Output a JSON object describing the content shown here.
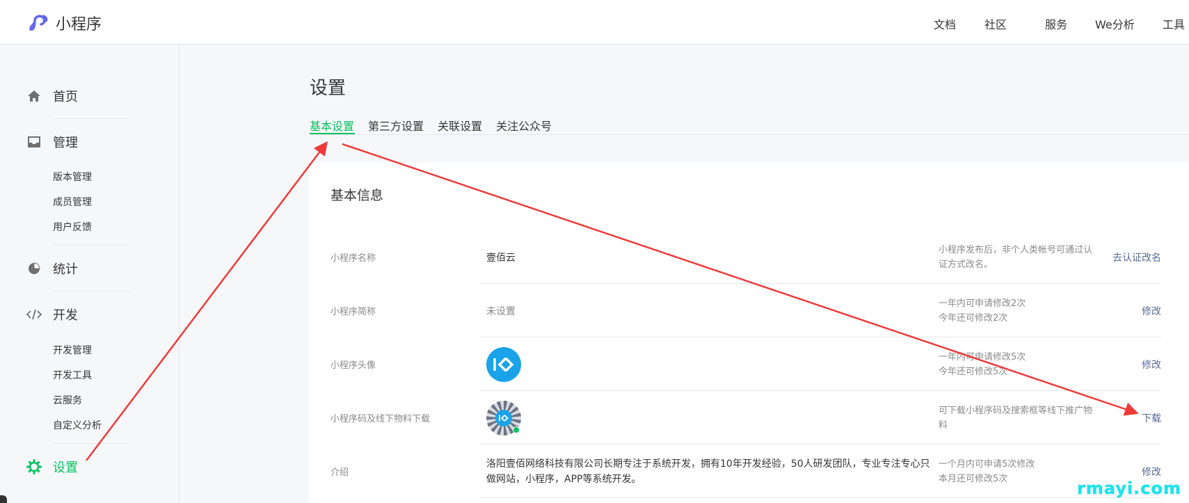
{
  "header": {
    "logo_text": "小程序",
    "nav": [
      {
        "label": "文档"
      },
      {
        "label": "社区",
        "caret": "⌵"
      },
      {
        "label": "服务"
      },
      {
        "label": "We分析"
      },
      {
        "label": "工具",
        "caret": "⌵"
      }
    ]
  },
  "sidebar": {
    "groups": [
      {
        "label": "首页",
        "icon": "home-icon"
      },
      {
        "label": "管理",
        "icon": "inbox-icon",
        "items": [
          "版本管理",
          "成员管理",
          "用户反馈"
        ]
      },
      {
        "label": "统计",
        "icon": "pie-chart-icon"
      },
      {
        "label": "开发",
        "icon": "code-icon",
        "items": [
          "开发管理",
          "开发工具",
          "云服务",
          "自定义分析"
        ]
      },
      {
        "label": "设置",
        "icon": "gear-icon",
        "active": true
      }
    ]
  },
  "main": {
    "title": "设置",
    "tabs": [
      {
        "label": "基本设置",
        "active": true
      },
      {
        "label": "第三方设置"
      },
      {
        "label": "关联设置"
      },
      {
        "label": "关注公众号"
      }
    ],
    "section_title": "基本信息",
    "rows": [
      {
        "label": "小程序名称",
        "value": "壹佰云",
        "note": [
          "小程序发布后，非个人类帐号可通过认",
          "证方式改名。"
        ],
        "action": "去认证改名"
      },
      {
        "label": "小程序简称",
        "value": "未设置",
        "note": [
          "一年内可申请修改2次",
          "今年还可修改2次"
        ],
        "action": "修改"
      },
      {
        "label": "小程序头像",
        "value": "",
        "note": [
          "一年内可申请修改5次",
          "今年还可修改5次"
        ],
        "action": "修改"
      },
      {
        "label": "小程序码及线下物料下载",
        "value": "",
        "note": [
          "可下载小程序码及搜索框等线下推广物",
          "料"
        ],
        "action": "下载"
      },
      {
        "label": "介绍",
        "value": "洛阳壹佰网络科技有限公司长期专注于系统开发，拥有10年开发经验，50人研发团队，专业专注专心只做网站，小程序，APP等系统开发。",
        "note": [
          "一个月内可申请5次修改",
          "本月还可修改5次"
        ],
        "action": "修改"
      }
    ]
  },
  "watermark": "rmayi.com",
  "colors": {
    "accent": "#07c160",
    "link": "#576b95",
    "annotation_arrow": "#ee3a3a"
  }
}
